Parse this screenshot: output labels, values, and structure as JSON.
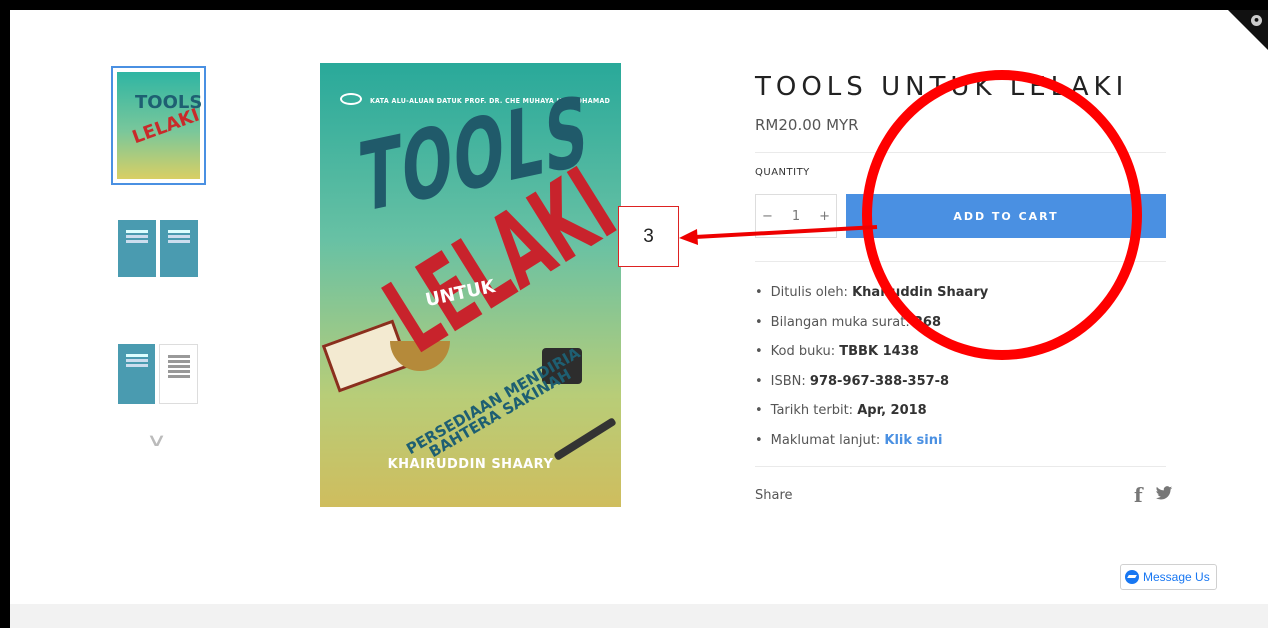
{
  "product": {
    "title": "TOOLS UNTUK LELAKI",
    "price": "RM20.00 MYR",
    "quantity_label": "QUANTITY",
    "quantity_value": "1",
    "qty_minus": "−",
    "qty_plus": "+",
    "add_to_cart_label": "ADD TO CART",
    "details": [
      {
        "label": "Ditulis oleh:",
        "value": "Khairuddin Shaary"
      },
      {
        "label": "Bilangan muka surat:",
        "value": "268"
      },
      {
        "label": "Kod buku:",
        "value": "TBBK 1438"
      },
      {
        "label": "ISBN:",
        "value": "978-967-388-357-8"
      },
      {
        "label": "Tarikh terbit:",
        "value": "Apr, 2018"
      },
      {
        "label": "Maklumat lanjut:",
        "value": "Klik sini"
      }
    ],
    "share_label": "Share"
  },
  "cover": {
    "foreword": "KATA ALU-ALUAN DATUK PROF. DR. CHE MUHAYA HJ. MOHAMAD",
    "word_tools": "TOOLS",
    "word_untuk": "UNTUK",
    "word_lelaki": "LELAKI",
    "subtitle_line1": "PERSEDIAAN MENDIRIA",
    "subtitle_line2": "BAHTERA SAKINAH",
    "author": "KHAIRUDDIN SHAARY"
  },
  "thumbnails": {
    "mini_word_tools": "TOOLS",
    "mini_word_lelaki": "LELAKI",
    "more_icon": "chevron-down-icon"
  },
  "messenger": {
    "label": "Message Us",
    "icon": "messenger-icon"
  },
  "annotation": {
    "number": "3",
    "color": "#ff0000"
  },
  "colors": {
    "accent": "#4a90e2",
    "annotation": "#ff0000"
  }
}
